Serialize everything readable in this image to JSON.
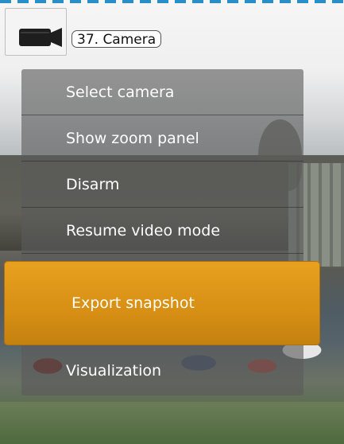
{
  "camera": {
    "label": "37. Camera",
    "icon": "video-camera-icon"
  },
  "context_menu": {
    "items": [
      {
        "label": "Select camera"
      },
      {
        "label": "Show zoom panel"
      },
      {
        "label": "Disarm"
      },
      {
        "label": "Resume video mode"
      },
      {
        "label": "Export snapshot",
        "highlighted": true
      },
      {
        "label": "Visualization"
      }
    ]
  },
  "colors": {
    "highlight": "#e09a1a",
    "menu_bg": "#5a5a5a",
    "accent_border": "#2a8fc9"
  }
}
